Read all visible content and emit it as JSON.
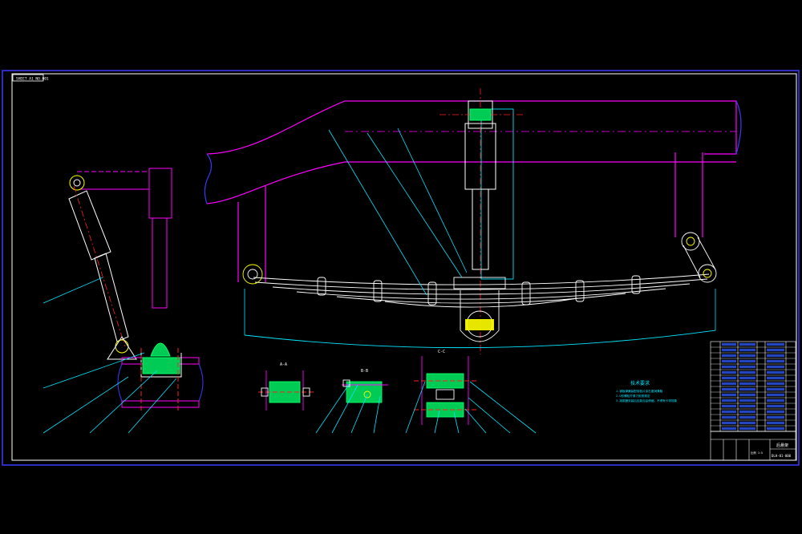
{
  "drawing": {
    "stamp": "SHEET A1 NO.001",
    "colors": {
      "background": "#000000",
      "border": "#3a3aff",
      "frame": "#ffffff",
      "magenta": "#ff00ff",
      "cyan": "#00e5ff",
      "green": "#00ff66",
      "red": "#ff2020",
      "yellow": "#ffff00"
    },
    "technical_requirements": {
      "heading": "技术要求",
      "lines": [
        "1.钢板弹簧装配前各片涂石墨润滑脂",
        "2.U形螺栓拧紧力矩按规定",
        "3.减振器安装后应能自由伸缩，不得有卡滞现象"
      ]
    },
    "section_labels": [
      "A-A",
      "B-B",
      "C-C"
    ],
    "title_block": {
      "drawing_name": "后悬架",
      "drawing_number": "DLH-01-000",
      "scale_caption": "比例 1:5"
    }
  }
}
